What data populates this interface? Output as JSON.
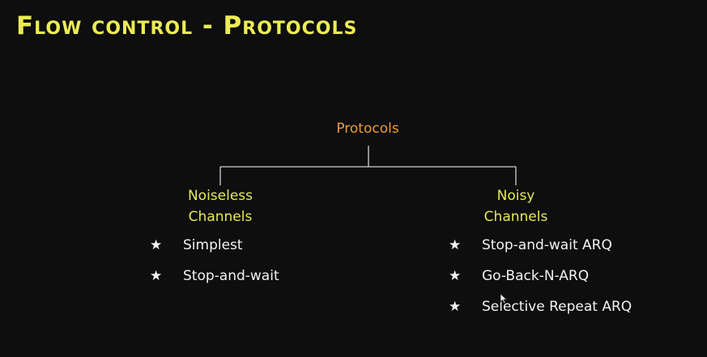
{
  "slide": {
    "title": "Flow control - Protocols"
  },
  "diagram": {
    "root": "Protocols",
    "branches": [
      {
        "label_lines": [
          "Noiseless",
          "Channels"
        ],
        "items": [
          "Simplest",
          "Stop-and-wait"
        ]
      },
      {
        "label_lines": [
          "Noisy",
          "Channels"
        ],
        "items": [
          "Stop-and-wait ARQ",
          "Go-Back-N-ARQ",
          "Selective Repeat ARQ"
        ]
      }
    ],
    "bullet_symbol": "★"
  },
  "colors": {
    "background": "#0d0e0d",
    "title": "#ecec55",
    "root": "#ef9a3c",
    "branch": "#e6e85a",
    "items": "#f2f2f2",
    "lines": "#d0d0d0"
  },
  "icons": {
    "bullet": "star-icon",
    "pointer": "mouse-pointer-icon"
  }
}
